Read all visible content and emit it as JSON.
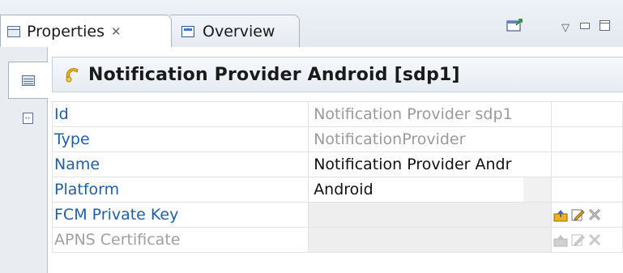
{
  "tabs": {
    "properties": {
      "label": "Properties",
      "close": "✕"
    },
    "overview": {
      "label": "Overview"
    }
  },
  "toolbar": {
    "view_menu": "▽"
  },
  "header": {
    "title": "Notification Provider Android [sdp1]"
  },
  "properties": [
    {
      "key": "Id",
      "value": "Notification Provider sdp1",
      "editable": false
    },
    {
      "key": "Type",
      "value": "NotificationProvider",
      "editable": false
    },
    {
      "key": "Name",
      "value": "Notification Provider Andr",
      "editable": true
    },
    {
      "key": "Platform",
      "value": "Android",
      "editable": true
    },
    {
      "key": "FCM Private Key",
      "value": "",
      "editable": true
    },
    {
      "key": "APNS Certificate",
      "value": "",
      "editable": false
    }
  ],
  "colors": {
    "key_link": "#1f5faa",
    "disabled": "#a0a0a0",
    "empty_cell": "#eeeeee"
  }
}
